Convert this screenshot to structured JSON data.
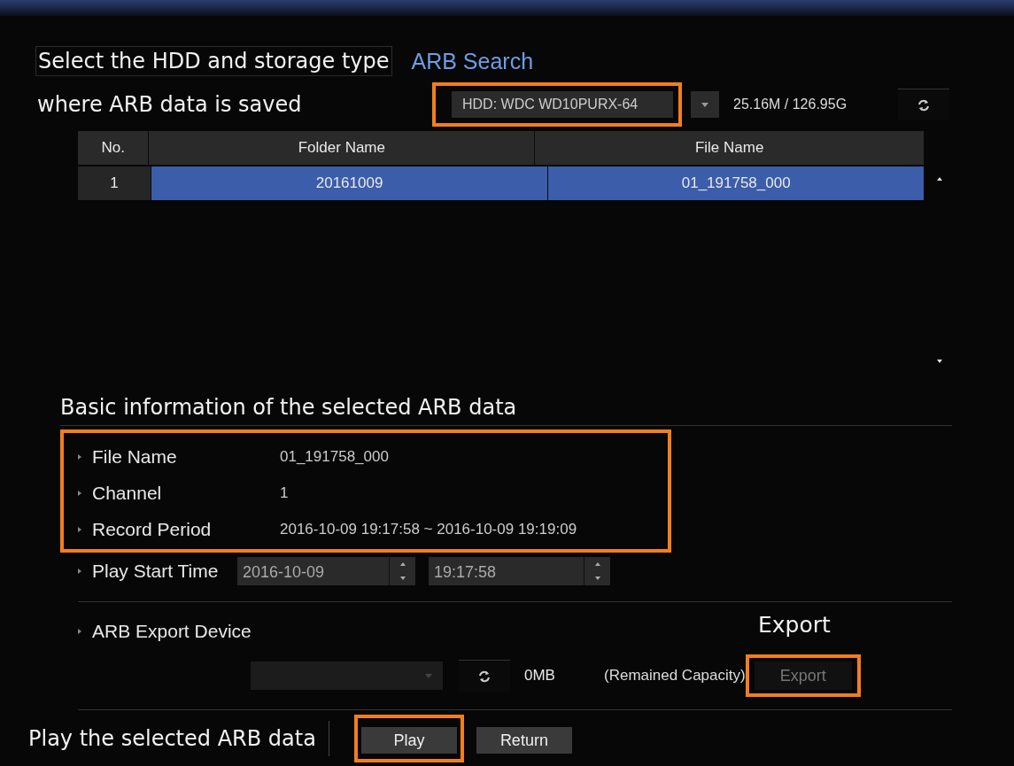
{
  "notes": {
    "storage": [
      "Select the HDD and storage type",
      "where ARB data is saved"
    ],
    "info": "Basic information of the selected ARB data",
    "export": "Export",
    "play": "Play the selected ARB data"
  },
  "title": "ARB Search",
  "hdd": {
    "value": "HDD: WDC WD10PURX-64",
    "capacity": "25.16M / 126.95G",
    "highlighted": true
  },
  "table": {
    "columns": [
      "No.",
      "Folder Name",
      "File Name"
    ],
    "rows": [
      {
        "cells": [
          "1",
          "20161009",
          "01_191758_000"
        ],
        "selected": true
      }
    ]
  },
  "info": {
    "highlighted": true,
    "items": [
      {
        "label": "File Name",
        "value": "01_191758_000"
      },
      {
        "label": "Channel",
        "value": "1"
      },
      {
        "label": "Record Period",
        "value": "2016-10-09 19:17:58 ~ 2016-10-09 19:19:09"
      }
    ]
  },
  "play_start": {
    "label": "Play Start Time",
    "date": "2016-10-09",
    "time": "19:17:58"
  },
  "export": {
    "label": "ARB Export Device",
    "capacity": "0MB",
    "capacity_note": "(Remained Capacity)",
    "button": "Export",
    "disabled": true,
    "highlighted": true
  },
  "buttons": [
    {
      "label": "Play",
      "highlighted": true
    },
    {
      "label": "Return",
      "highlighted": false
    }
  ]
}
